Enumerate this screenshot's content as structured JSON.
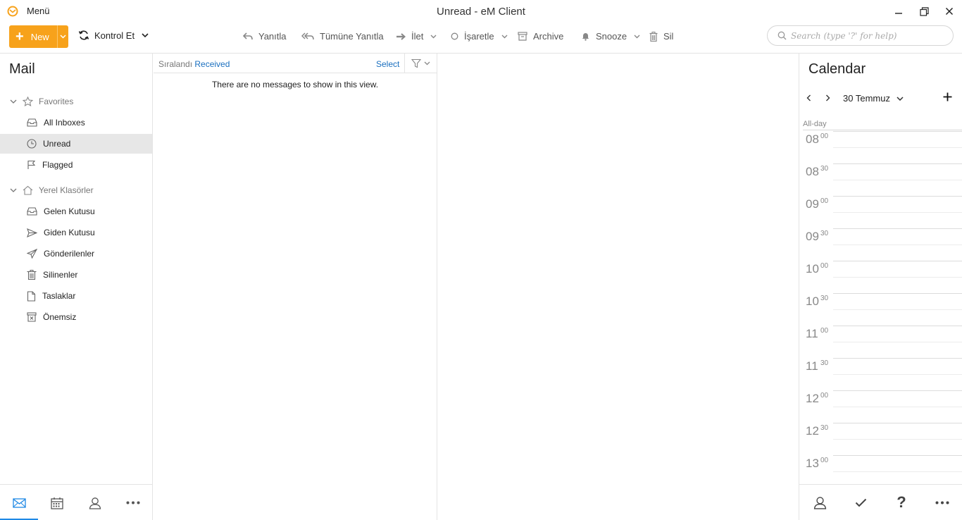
{
  "window": {
    "menu_label": "Menü",
    "title": "Unread - eM Client"
  },
  "toolbar": {
    "new_label": "New",
    "kontrol_label": "Kontrol Et",
    "reply_label": "Yanıtla",
    "reply_all_label": "Tümüne Yanıtla",
    "forward_label": "İlet",
    "mark_label": "İşaretle",
    "archive_label": "Archive",
    "snooze_label": "Snooze",
    "delete_label": "Sil",
    "search_placeholder": "Search (type '?' for help)"
  },
  "sidebar": {
    "title": "Mail",
    "favorites_label": "Favorites",
    "favorites": [
      {
        "label": "All Inboxes"
      },
      {
        "label": "Unread"
      },
      {
        "label": "Flagged"
      }
    ],
    "local_label": "Yerel Klasörler",
    "local": [
      {
        "label": "Gelen Kutusu"
      },
      {
        "label": "Giden Kutusu"
      },
      {
        "label": "Gönderilenler"
      },
      {
        "label": "Silinenler"
      },
      {
        "label": "Taslaklar"
      },
      {
        "label": "Önemsiz"
      }
    ]
  },
  "msglist": {
    "sort_prefix": "Sıralandı",
    "sort_value": "Received",
    "select_label": "Select",
    "empty_text": "There are no messages to show in this view."
  },
  "calendar": {
    "title": "Calendar",
    "date_label": "30 Temmuz",
    "allday_label": "All-day",
    "hours": [
      {
        "h": "08",
        "m": "00"
      },
      {
        "h": "08",
        "m": "30"
      },
      {
        "h": "09",
        "m": "00"
      },
      {
        "h": "09",
        "m": "30"
      },
      {
        "h": "10",
        "m": "00"
      },
      {
        "h": "10",
        "m": "30"
      },
      {
        "h": "11",
        "m": "00"
      },
      {
        "h": "11",
        "m": "30"
      },
      {
        "h": "12",
        "m": "00"
      },
      {
        "h": "12",
        "m": "30"
      },
      {
        "h": "13",
        "m": "00"
      }
    ]
  },
  "colors": {
    "accent": "#f7a21b",
    "link": "#1a6fbf",
    "nav_active": "#1e88e5"
  }
}
